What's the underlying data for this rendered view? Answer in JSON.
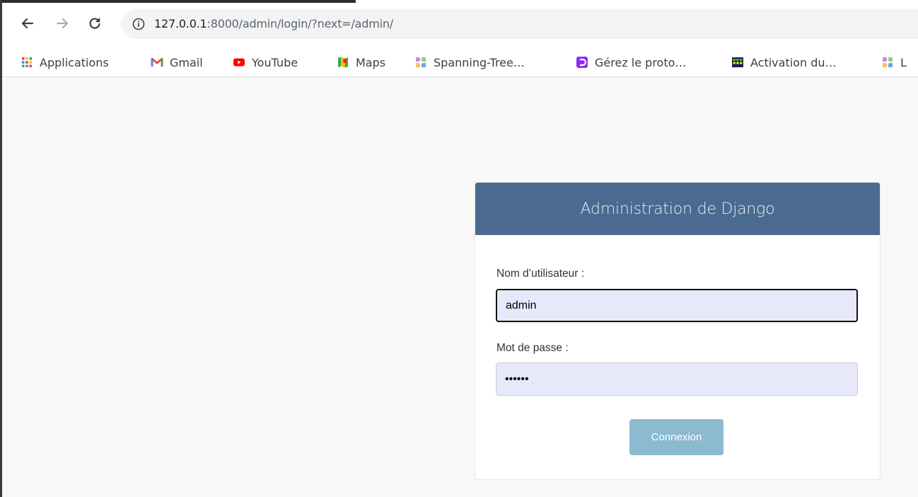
{
  "browser": {
    "url_host": "127.0.0.1",
    "url_rest": ":8000/admin/login/?next=/admin/",
    "bookmarks": [
      {
        "label": "Applications",
        "icon": "apps-grid-icon"
      },
      {
        "label": "Gmail",
        "icon": "gmail-icon"
      },
      {
        "label": "YouTube",
        "icon": "youtube-icon"
      },
      {
        "label": "Maps",
        "icon": "maps-icon"
      },
      {
        "label": "Spanning-Tree…",
        "icon": "puzzle-favicon-icon"
      },
      {
        "label": "Gérez le proto…",
        "icon": "purple-favicon-icon"
      },
      {
        "label": "Activation du…",
        "icon": "grid-favicon-icon"
      },
      {
        "label": "L",
        "icon": "puzzle-favicon-icon"
      }
    ]
  },
  "login": {
    "title": "Administration de Django",
    "username_label": "Nom d’utilisateur :",
    "username_value": "admin",
    "password_label": "Mot de passe :",
    "password_value": "••••••",
    "submit_label": "Connexion"
  },
  "colors": {
    "header_bg": "#4a6b8f",
    "button_bg": "#79aec8",
    "input_bg": "#e8e8fb"
  }
}
